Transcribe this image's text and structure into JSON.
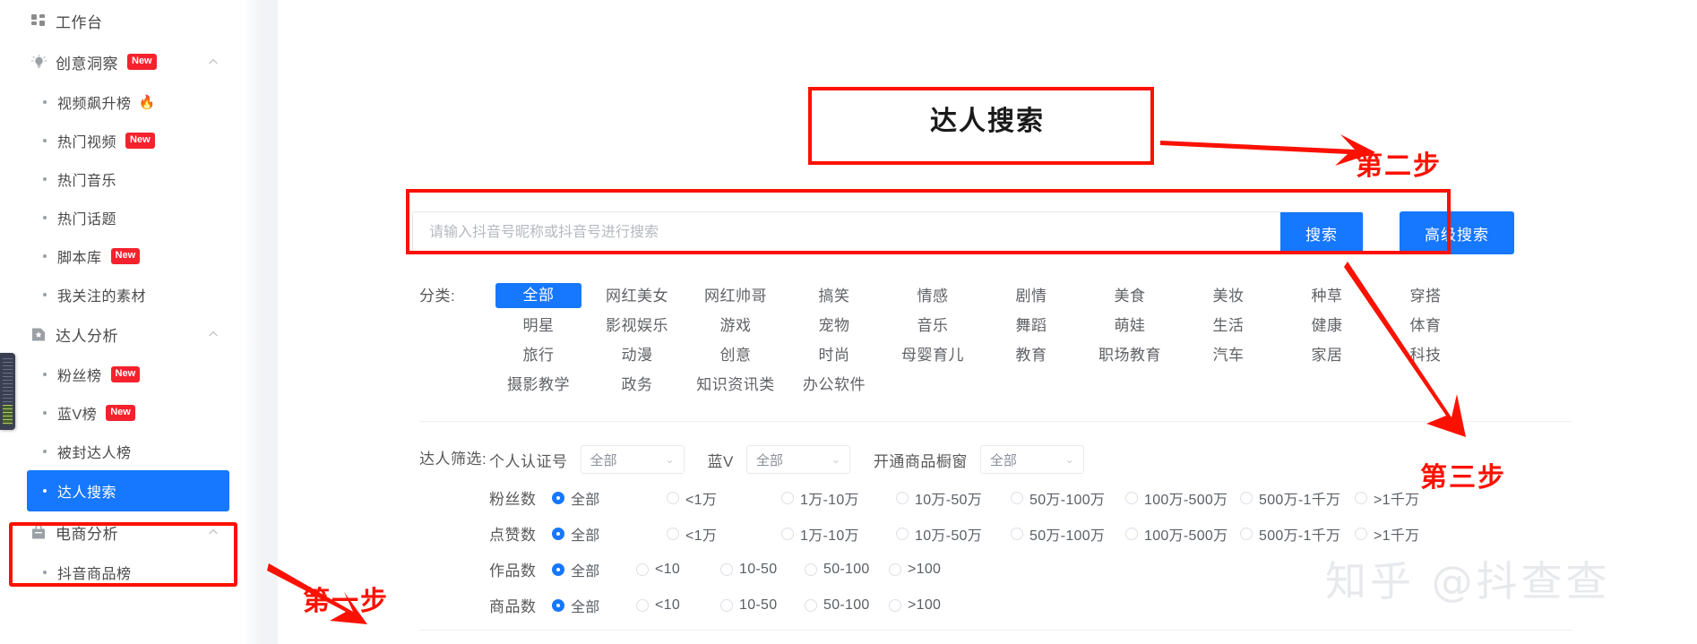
{
  "sidebar": {
    "groups": [
      {
        "type": "top",
        "icon": "grid-icon",
        "label": "工作台",
        "badge": null,
        "chevron": false
      },
      {
        "type": "top",
        "icon": "lightbulb-icon",
        "label": "创意洞察",
        "badge": "New",
        "chevron": true
      },
      {
        "type": "sub",
        "label": "视频飙升榜",
        "badge": null,
        "fire": "🔥"
      },
      {
        "type": "sub",
        "label": "热门视频",
        "badge": "New"
      },
      {
        "type": "sub",
        "label": "热门音乐",
        "badge": null
      },
      {
        "type": "sub",
        "label": "热门话题",
        "badge": null
      },
      {
        "type": "sub",
        "label": "脚本库",
        "badge": "New"
      },
      {
        "type": "sub",
        "label": "我关注的素材",
        "badge": null
      },
      {
        "type": "top",
        "icon": "file-star-icon",
        "label": "达人分析",
        "badge": null,
        "chevron": true
      },
      {
        "type": "sub",
        "label": "粉丝榜",
        "badge": "New"
      },
      {
        "type": "sub",
        "label": "蓝V榜",
        "badge": "New"
      },
      {
        "type": "sub",
        "label": "被封达人榜",
        "badge": null
      },
      {
        "type": "sub",
        "label": "达人搜索",
        "badge": null,
        "active": true
      },
      {
        "type": "top",
        "icon": "cart-icon",
        "label": "电商分析",
        "badge": null,
        "chevron": true
      },
      {
        "type": "sub",
        "label": "抖音商品榜",
        "badge": null
      }
    ]
  },
  "main": {
    "title": "达人搜索",
    "search": {
      "placeholder": "请输入抖音号昵称或抖音号进行搜索",
      "value": "",
      "search_label": "搜索",
      "advanced_label": "高级搜索"
    },
    "category": {
      "label": "分类:",
      "items": [
        "全部",
        "网红美女",
        "网红帅哥",
        "搞笑",
        "情感",
        "剧情",
        "美食",
        "美妆",
        "种草",
        "穿搭",
        "明星",
        "影视娱乐",
        "游戏",
        "宠物",
        "音乐",
        "舞蹈",
        "萌娃",
        "生活",
        "健康",
        "体育",
        "旅行",
        "动漫",
        "创意",
        "时尚",
        "母婴育儿",
        "教育",
        "职场教育",
        "汽车",
        "家居",
        "科技",
        "摄影教学",
        "政务",
        "知识资讯类",
        "办公软件"
      ],
      "selected": "全部"
    },
    "filters": {
      "label": "达人筛选:",
      "selects": [
        {
          "label": "个人认证号",
          "value": "全部"
        },
        {
          "label": "蓝V",
          "value": "全部"
        },
        {
          "label": "开通商品橱窗",
          "value": "全部"
        }
      ],
      "radio_groups": [
        {
          "label": "粉丝数",
          "options": [
            "全部",
            "<1万",
            "1万-10万",
            "10万-50万",
            "50万-100万",
            "100万-500万",
            "500万-1千万",
            ">1千万"
          ],
          "selected": "全部"
        },
        {
          "label": "点赞数",
          "options": [
            "全部",
            "<1万",
            "1万-10万",
            "10万-50万",
            "50万-100万",
            "100万-500万",
            "500万-1千万",
            ">1千万"
          ],
          "selected": "全部"
        },
        {
          "label": "作品数",
          "options": [
            "全部",
            "<10",
            "10-50",
            "50-100",
            ">100"
          ],
          "selected": "全部"
        },
        {
          "label": "商品数",
          "options": [
            "全部",
            "<10",
            "10-50",
            "50-100",
            ">100"
          ],
          "selected": "全部"
        }
      ]
    }
  },
  "annotations": {
    "step1": "第一步",
    "step2": "第二步",
    "step3": "第三步",
    "accent_color": "#fb1100"
  },
  "watermark": "知乎 @抖查查"
}
